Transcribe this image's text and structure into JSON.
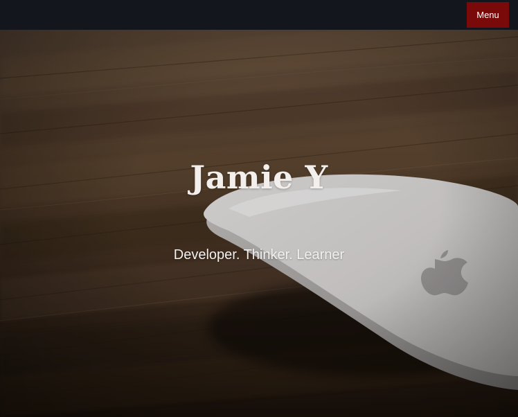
{
  "nav": {
    "menu_label": "Menu"
  },
  "hero": {
    "title": "Jamie Y",
    "subtitle": "Developer. Thinker. Learner",
    "background_description_icon": "mouse-on-wood-photo"
  },
  "colors": {
    "topbar": "#14161d",
    "menu_button": "#7a0a0a",
    "title_text": "#f2efec",
    "wood_dark": "#2a1d14",
    "wood_mid": "#5a4330"
  }
}
